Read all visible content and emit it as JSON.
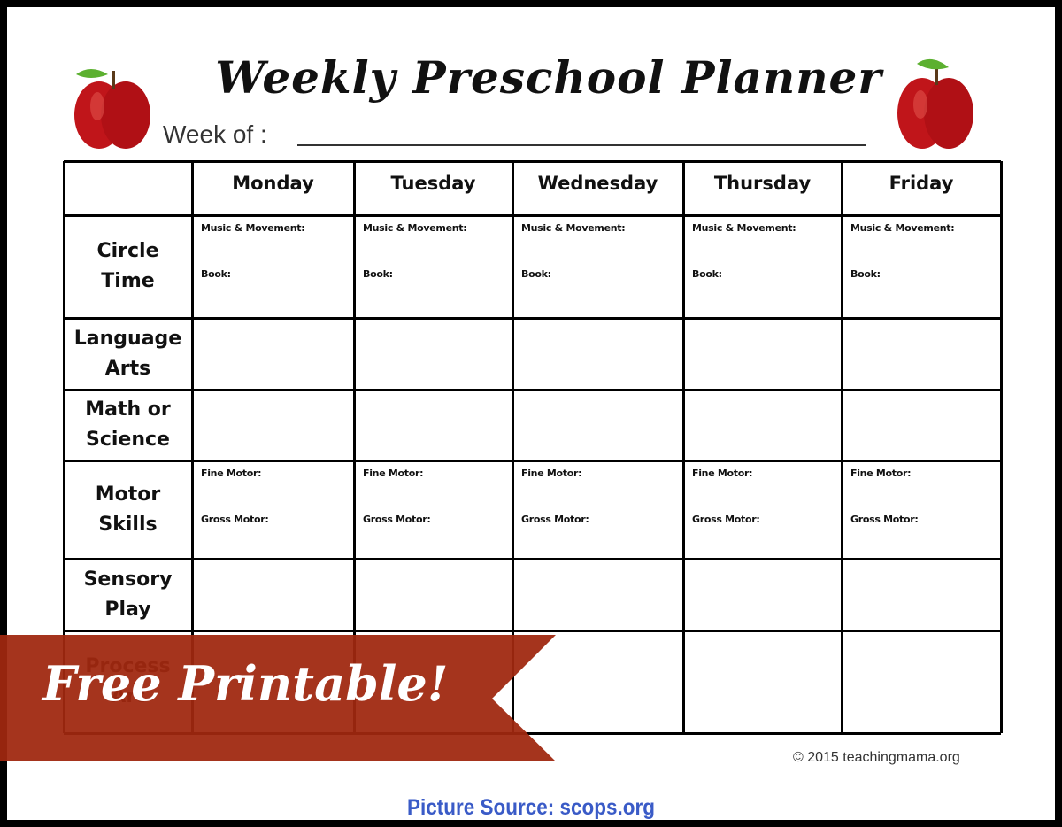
{
  "title": "Weekly Preschool Planner",
  "week_of_label": "Week of :",
  "days": [
    "Monday",
    "Tuesday",
    "Wednesday",
    "Thursday",
    "Friday"
  ],
  "rows": [
    {
      "label": "Circle\nTime",
      "fields": [
        "Music & Movement:",
        "Book:"
      ]
    },
    {
      "label": "Language\nArts",
      "fields": []
    },
    {
      "label": "Math or\nScience",
      "fields": []
    },
    {
      "label": "Motor\nSkills",
      "fields": [
        "Fine Motor:",
        "Gross Motor:"
      ]
    },
    {
      "label": "Sensory\nPlay",
      "fields": []
    },
    {
      "label": "Process\nArt",
      "fields": []
    }
  ],
  "banner": {
    "text": "Free Printable!",
    "color": "#a0280f"
  },
  "copyright": "© 2015 teachingmama.org",
  "picture_source": "Picture Source: scops.org",
  "icons": [
    "apple-icon",
    "apple-icon"
  ]
}
